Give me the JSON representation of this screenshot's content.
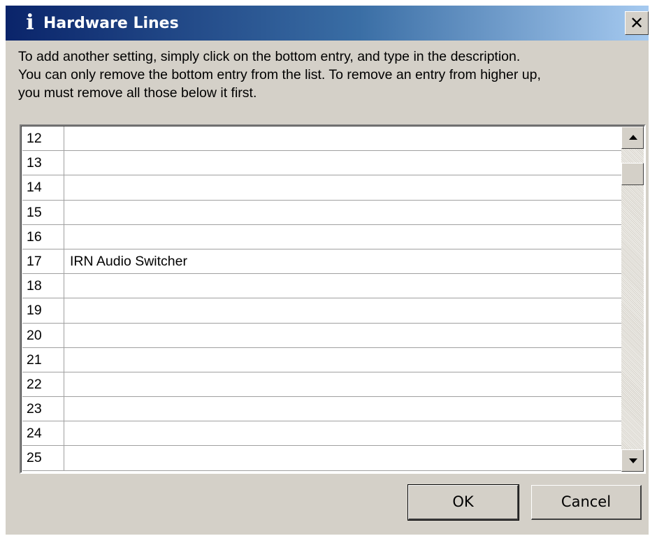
{
  "window": {
    "title": "Hardware Lines",
    "title_icon": "info-icon",
    "close_label": "✕"
  },
  "instructions": {
    "line1": "To add another setting, simply click on the bottom entry, and type in the description.",
    "line2": "You can only remove the bottom entry from the list. To remove an entry from higher up,",
    "line3": "you must remove all those below it first."
  },
  "grid": {
    "rows": [
      {
        "num": "12",
        "desc": ""
      },
      {
        "num": "13",
        "desc": ""
      },
      {
        "num": "14",
        "desc": ""
      },
      {
        "num": "15",
        "desc": ""
      },
      {
        "num": "16",
        "desc": ""
      },
      {
        "num": "17",
        "desc": "IRN Audio Switcher"
      },
      {
        "num": "18",
        "desc": ""
      },
      {
        "num": "19",
        "desc": ""
      },
      {
        "num": "20",
        "desc": ""
      },
      {
        "num": "21",
        "desc": ""
      },
      {
        "num": "22",
        "desc": ""
      },
      {
        "num": "23",
        "desc": ""
      },
      {
        "num": "24",
        "desc": ""
      },
      {
        "num": "25",
        "desc": ""
      }
    ]
  },
  "buttons": {
    "ok_label": "OK",
    "cancel_label": "Cancel"
  },
  "colors": {
    "title_start": "#0a246a",
    "title_end": "#a6caf0",
    "face": "#d4d0c8"
  }
}
